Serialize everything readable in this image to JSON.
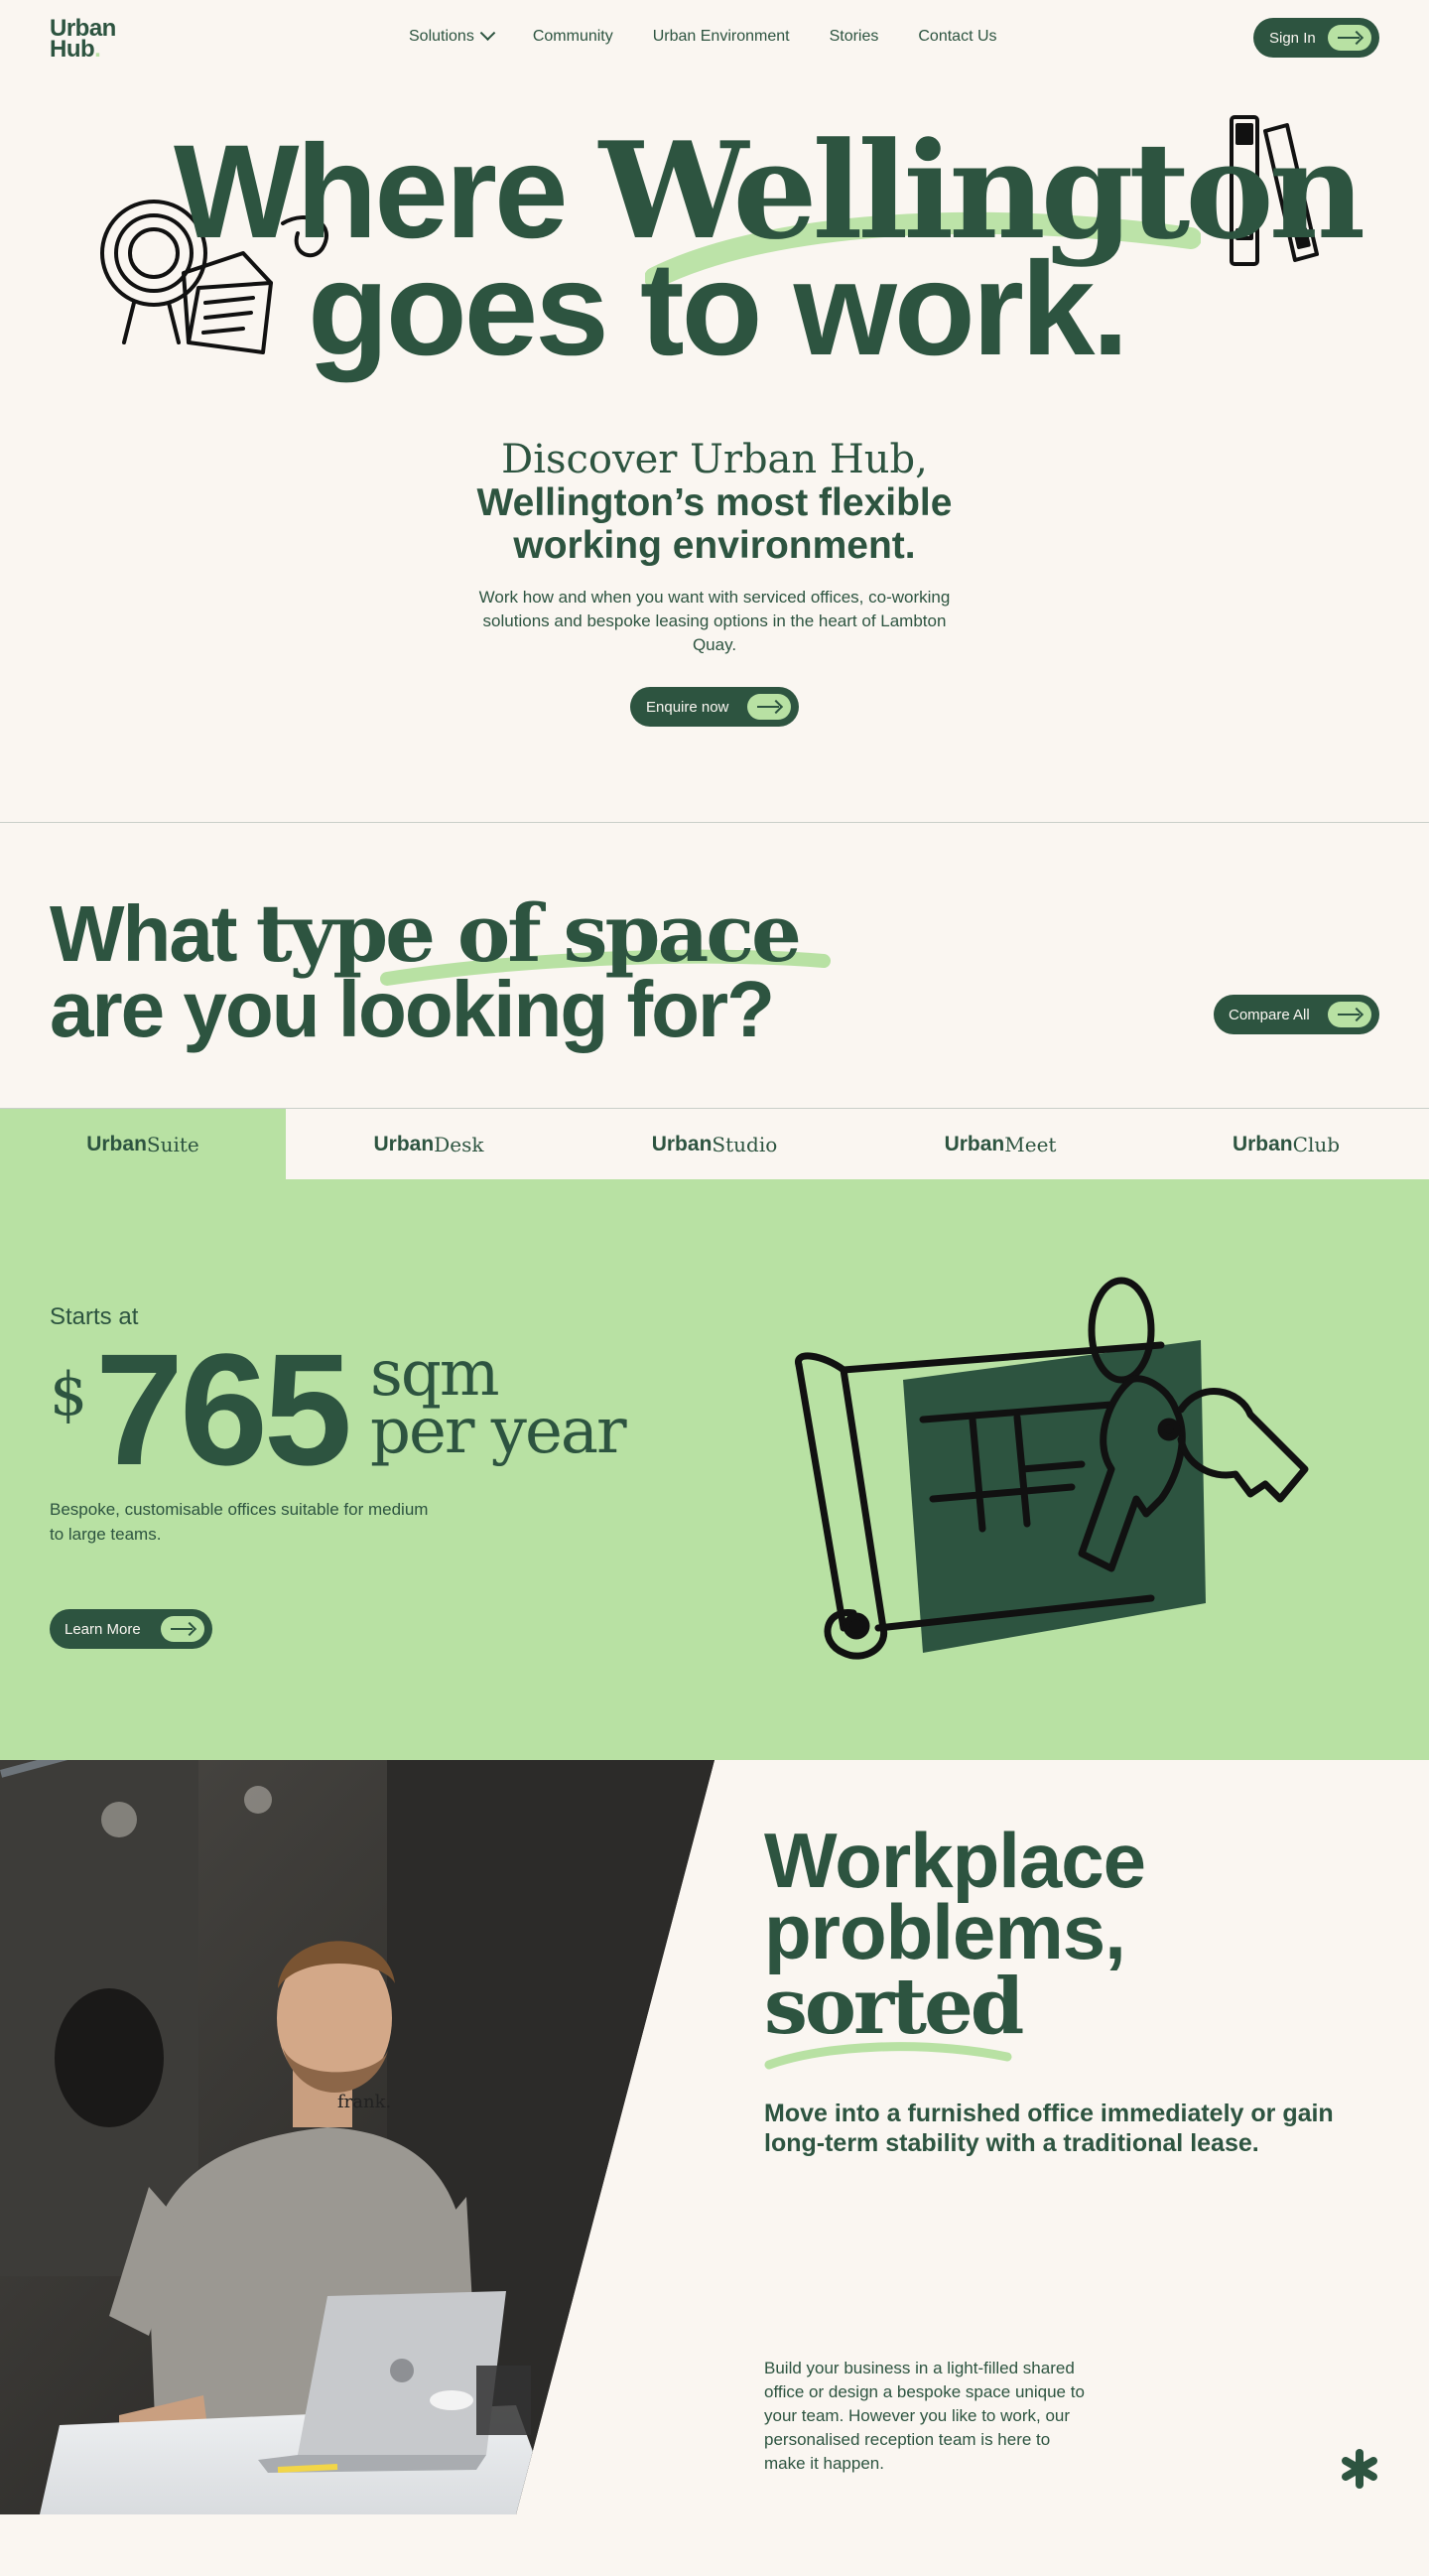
{
  "brand": {
    "logo_line1": "Urban",
    "logo_line2": "Hub"
  },
  "nav": {
    "solutions": "Solutions",
    "community": "Community",
    "urban_environment": "Urban Environment",
    "stories": "Stories",
    "contact": "Contact Us",
    "sign_in": "Sign In"
  },
  "hero": {
    "line1_a": "Where",
    "line1_b": "Wellington",
    "line2": "goes to work.",
    "discover_1": "Discover Urban Hub,",
    "discover_2": "Wellington’s most flexible",
    "discover_3": "working environment.",
    "description": "Work how and when you want with serviced offices, co-working solutions and bespoke leasing options in the heart of Lambton Quay.",
    "cta": "Enquire now"
  },
  "spaces": {
    "heading_a": "What",
    "heading_b": "type of space",
    "heading_line2": "are you looking for?",
    "compare": "Compare All",
    "tabs": [
      {
        "bold": "Urban",
        "light": "Suite"
      },
      {
        "bold": "Urban",
        "light": "Desk"
      },
      {
        "bold": "Urban",
        "light": "Studio"
      },
      {
        "bold": "Urban",
        "light": "Meet"
      },
      {
        "bold": "Urban",
        "light": "Club"
      }
    ],
    "active_tab": "UrbanSuite",
    "starts_at": "Starts at",
    "currency": "$",
    "price": "765",
    "unit_line1": "sqm",
    "unit_line2": "per year",
    "description": "Bespoke, customisable offices suitable for medium to large teams.",
    "learn_more": "Learn More"
  },
  "workplace": {
    "heading_1": "Workplace",
    "heading_2": "problems,",
    "heading_3": "sorted",
    "subheading": "Move into a furnished office immediately or gain long-term stability with a traditional lease.",
    "body": "Build your business in a light-filled shared office or design a bespoke space unique to your team. However you like to work, our personalised reception team is here to make it happen.",
    "shirt_logo": "frank."
  },
  "colors": {
    "brand_dark": "#2d5440",
    "accent_green": "#b8e1a3",
    "background": "#faf6f1"
  }
}
